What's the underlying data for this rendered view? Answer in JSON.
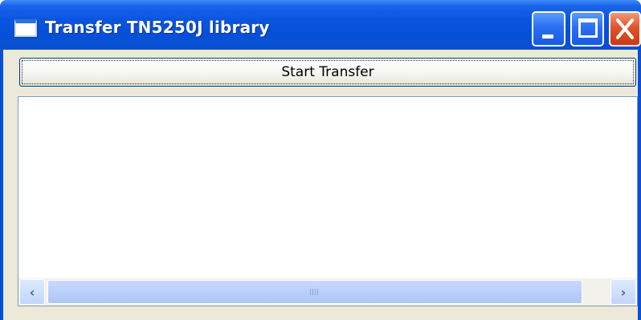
{
  "window": {
    "title": "Transfer TN5250J library",
    "icon": "app-window-icon",
    "controls": [
      "minimize-icon",
      "maximize-icon",
      "close-icon"
    ],
    "accent_color": "#0a4fd8",
    "close_color": "#e0542c"
  },
  "main": {
    "start_button_label": "Start Transfer"
  },
  "scrollbar": {
    "left_arrow": "‹",
    "right_arrow": "›"
  }
}
